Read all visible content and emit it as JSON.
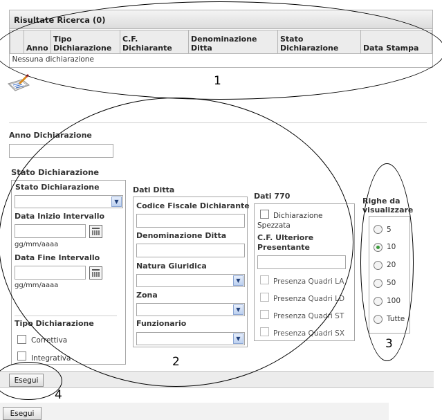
{
  "results": {
    "title": "Risultate Ricerca (0)",
    "columns": [
      "Anno",
      "Tipo Dichiarazione",
      "C.F. Dichiarante",
      "Denominazione Ditta",
      "Stato Dichiarazione",
      "Data Stampa"
    ],
    "empty_message": "Nessuna dichiarazione"
  },
  "annotations": {
    "n1": "1",
    "n2": "2",
    "n3": "3",
    "n4": "4"
  },
  "anno": {
    "label": "Anno Dichiarazione",
    "value": ""
  },
  "stato_section": {
    "title": "Stato Dichiarazione",
    "stato_label": "Stato Dichiarazione",
    "stato_value": "",
    "data_inizio_label": "Data Inizio Intervallo",
    "data_inizio_value": "",
    "data_inizio_hint": "gg/mm/aaaa",
    "data_fine_label": "Data Fine Intervallo",
    "data_fine_value": "",
    "data_fine_hint": "gg/mm/aaaa",
    "tipo_label": "Tipo Dichiarazione",
    "correttiva_label": "Correttiva",
    "integrativa_label": "Integrativa"
  },
  "dati_ditta": {
    "title": "Dati Ditta",
    "cf_label": "Codice Fiscale Dichiarante",
    "cf_value": "",
    "denominazione_label": "Denominazione Ditta",
    "denominazione_value": "",
    "natura_label": "Natura Giuridica",
    "natura_value": "",
    "zona_label": "Zona",
    "zona_value": "",
    "funzionario_label": "Funzionario",
    "funzionario_value": ""
  },
  "dati_770": {
    "title": "Dati 770",
    "spezzata_label_1": "Dichiarazione",
    "spezzata_label_2": "Spezzata",
    "cf_ulteriore_label_1": "C.F. Ulteriore",
    "cf_ulteriore_label_2": "Presentante",
    "cf_ulteriore_value": "",
    "quadri": [
      "Presenza Quadri LA",
      "Presenza Quadri LD",
      "Presenza Quadri ST",
      "Presenza Quadri SX"
    ]
  },
  "righe": {
    "title_1": "Righe da",
    "title_2": "visualizzare",
    "options": [
      "5",
      "10",
      "20",
      "50",
      "100",
      "Tutte"
    ],
    "selected": "10"
  },
  "buttons": {
    "esegui": "Esegui",
    "esegui_bottom": "Esegui"
  }
}
